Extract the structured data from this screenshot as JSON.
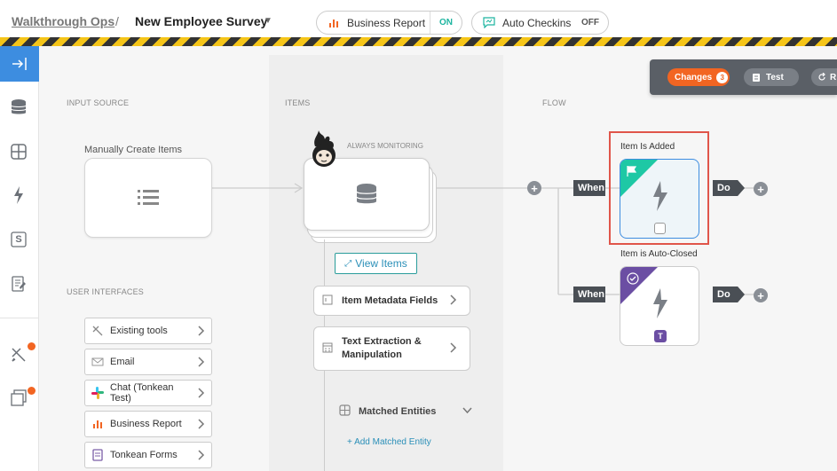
{
  "header": {
    "breadcrumb_parent": "Walkthrough Ops",
    "separator": "/",
    "title": "New Employee Survey",
    "business_report": {
      "label": "Business Report",
      "state": "ON"
    },
    "auto_checkins": {
      "label": "Auto Checkins",
      "state": "OFF"
    }
  },
  "sidebar": {
    "icons": [
      "collapse-icon",
      "database-icon",
      "grid-icon",
      "lightning-icon",
      "s-letter-icon",
      "form-icon",
      "tools-icon",
      "layers-icon"
    ],
    "s_letter": "S"
  },
  "columns": {
    "input_source": "INPUT SOURCE",
    "items": "ITEMS",
    "flow": "FLOW",
    "user_interfaces": "USER INTERFACES"
  },
  "input_source": {
    "label": "Manually Create Items"
  },
  "user_interfaces": [
    {
      "label": "Existing tools",
      "icon": "cursor-icon"
    },
    {
      "label": "Email",
      "icon": "email-icon"
    },
    {
      "label": "Chat (Tonkean Test)",
      "icon": "slack-icon"
    },
    {
      "label": "Business Report",
      "icon": "report-icon"
    },
    {
      "label": "Tonkean Forms",
      "icon": "form-icon"
    }
  ],
  "items": {
    "monitoring": "ALWAYS MONITORING",
    "view_items": "View Items",
    "metadata": "Item Metadata Fields",
    "text_extraction_line1": "Text Extraction &",
    "text_extraction_line2": "Manipulation",
    "matched_entities": "Matched Entities",
    "add_matched": "+ Add Matched Entity"
  },
  "flow": {
    "triggers": [
      {
        "label": "Item Is Added",
        "when": "When",
        "do": "Do",
        "color": "#1ec8a5"
      },
      {
        "label": "Item is Auto-Closed",
        "when": "When",
        "do": "Do",
        "color": "#6b4ea3",
        "badge": "T"
      }
    ],
    "plus": "+"
  },
  "toolbar": {
    "changes_label": "Changes",
    "changes_count": "3",
    "test_label": "Test",
    "r_label": "R"
  },
  "colors": {
    "accent": "#3d8de0",
    "orange": "#f26522",
    "teal": "#1db5a0",
    "purple": "#6b4ea3"
  }
}
